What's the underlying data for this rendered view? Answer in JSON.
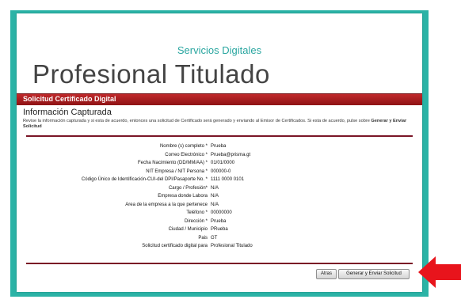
{
  "header": {
    "subtitle": "Servicios Digitales",
    "title": "Profesional Titulado"
  },
  "bar": {
    "label": "Solicitud Certificado Digital"
  },
  "section": {
    "title": "Información Capturada",
    "description_1": "Revise la información capturada y si esta de acuerdo, entonces una solicitud de Certificado será generado y enviando al Emisor de Certificados. Si esta de acuerdo, pulse sobre ",
    "description_bold": "Generar y Enviar Solicitud"
  },
  "fields": [
    {
      "label": "Nombre (s) completo *",
      "value": "Prueba"
    },
    {
      "label": "Correo Electrónico *",
      "value": "Prueba@prisma.gt"
    },
    {
      "label": "Fecha Nacimiento (DD/MM/AA) *",
      "value": "01/01/0000"
    },
    {
      "label": "NIT Empresa / NIT Persona *",
      "value": "000000-0"
    },
    {
      "label": "Código Único de Identificación-CUI-del DPI/Pasaporte No. *",
      "value": "1111 0000 0101"
    },
    {
      "label": "Cargo / Profesión*",
      "value": "N/A"
    },
    {
      "label": "Empresa donde Labora",
      "value": "N/A"
    },
    {
      "label": "Area de la empresa a la que pertenece",
      "value": "N/A"
    },
    {
      "label": "Teléfono *",
      "value": "00000000"
    },
    {
      "label": "Dirección *",
      "value": "Prueba"
    },
    {
      "label": "Ciudad / Municipio",
      "value": "PRueba"
    },
    {
      "label": "Pais",
      "value": "GT"
    },
    {
      "label": "Solicitud certificado digital para",
      "value": "Profesional Titulado"
    }
  ],
  "buttons": {
    "back": "Atras",
    "submit": "Generar y Enviar Solicitud"
  },
  "colors": {
    "frame": "#2bb3a6",
    "bar": "#a41d20",
    "arrow": "#e8141c"
  }
}
